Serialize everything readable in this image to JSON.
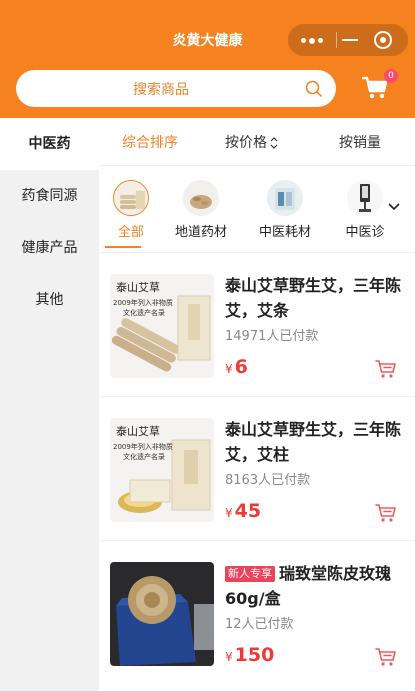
{
  "app": {
    "title": "炎黄大健康"
  },
  "header": {
    "search": {
      "placeholder": "搜索商品"
    },
    "cart": {
      "badge": "0"
    }
  },
  "sidebar": {
    "items": [
      {
        "label": "中医药",
        "active": true
      },
      {
        "label": "药食同源",
        "active": false
      },
      {
        "label": "健康产品",
        "active": false
      },
      {
        "label": "其他",
        "active": false
      }
    ]
  },
  "sort": {
    "tabs": [
      {
        "label": "综合排序",
        "active": true
      },
      {
        "label": "按价格",
        "active": false
      },
      {
        "label": "按销量",
        "active": false
      }
    ]
  },
  "subcategories": {
    "items": [
      {
        "label": "全部",
        "active": true
      },
      {
        "label": "地道药材",
        "active": false
      },
      {
        "label": "中医耗材",
        "active": false
      },
      {
        "label": "中医诊",
        "active": false
      }
    ]
  },
  "products": [
    {
      "title": "泰山艾草野生艾，三年陈艾，艾条",
      "tag": "",
      "sales": "14971人已付款",
      "currency": "¥",
      "price": "6",
      "image_brand": "泰山艾草",
      "image_caption_1": "2009年列入非物质",
      "image_caption_2": "文化遗产名录"
    },
    {
      "title": "泰山艾草野生艾，三年陈艾，艾柱",
      "tag": "",
      "sales": "8163人已付款",
      "currency": "¥",
      "price": "45",
      "image_brand": "泰山艾草",
      "image_caption_1": "2009年列入非物质",
      "image_caption_2": "文化遗产名录"
    },
    {
      "title": "瑞致堂陈皮玫瑰60g/盒",
      "tag": "新人专享",
      "sales": "12人已付款",
      "currency": "¥",
      "price": "150"
    }
  ],
  "colors": {
    "accent": "#f5811f",
    "price": "#ee3a3a",
    "tag": "#e8455a",
    "badge": "#ff4a6b"
  }
}
